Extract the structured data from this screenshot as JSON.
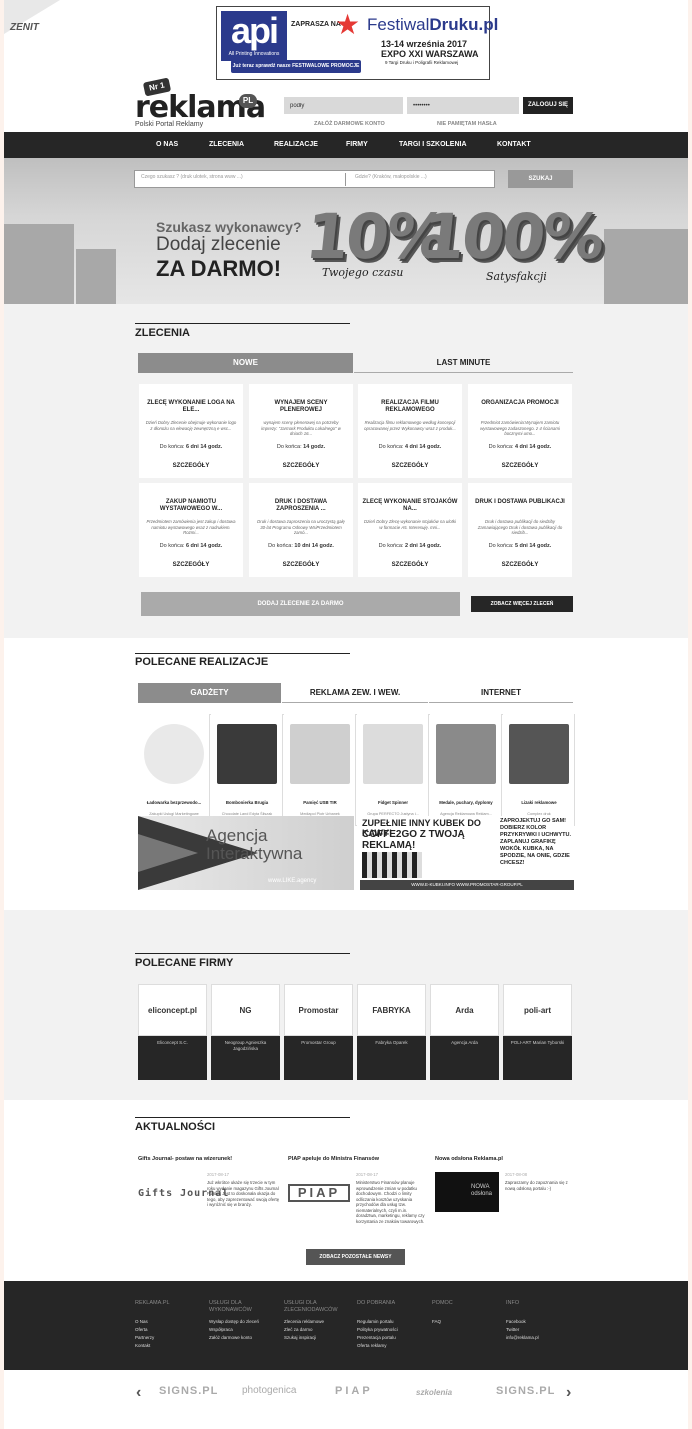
{
  "corner": {
    "text": "ZENIT"
  },
  "banner": {
    "api": "api",
    "api_sub": "All Printing Innovations",
    "zaprasza": "ZAPRASZA NA",
    "festival_a": "Festiwal",
    "festival_b": "Druku.pl",
    "date": "13-14 września 2017",
    "place": "EXPO XXI WARSZAWA",
    "targi": "9 Targi Druku i Poligrafii Reklamowej",
    "button": "Już teraz sprawdź nasze FESTIWALOWE PROMOCJE"
  },
  "header": {
    "logo_badge": "Nr 1",
    "logo": "reklama",
    "logo_pl": "PL",
    "logo_sub": "Polski Portal Reklamy",
    "login_value": "podły",
    "password_value": "••••••••",
    "login_button": "ZALOGUJ SIĘ",
    "create_account": "ZAŁÓŻ DARMOWE KONTO",
    "forgot_password": "NIE PAMIĘTAM HASŁA"
  },
  "nav": [
    "O NAS",
    "ZLECENIA",
    "REALIZACJE",
    "FIRMY",
    "TARGI I SZKOLENIA",
    "KONTAKT"
  ],
  "hero": {
    "search_what": "Czego szukasz ? (druk ulotek, strona www ...)",
    "search_where": "Gdzie? (Kraków, małopolskie ...)",
    "search_button": "SZUKAJ",
    "line1": "Szukasz wykonawcy?",
    "line2": "Dodaj zlecenie",
    "line3": "ZA DARMO!",
    "num1": "10%",
    "num2": "100%",
    "script1": "Twojego czasu",
    "script2": "Satysfakcji"
  },
  "zlecenia": {
    "title": "ZLECENIA",
    "tab_new": "NOWE",
    "tab_last": "LAST MINUTE",
    "deadline_label": "Do końca:",
    "details": "SZCZEGÓŁY",
    "cards": [
      {
        "title": "ZLECĘ WYKONANIE LOGA NA ELE...",
        "desc": "Dzień Dobry Zlecenie obejmuje wykonanie logo z dłonożu na elewację zewnętrzną e wsc...",
        "time": "6 dni 14 godz."
      },
      {
        "title": "WYNAJEM SCENY PLENEROWEJ",
        "desc": "wynajem sceny plenerowej na potrzeby imprezy: \"Jarmark Produktu Lokalnego\" w dniach 16...",
        "time": "14 godz."
      },
      {
        "title": "REALIZACJA FILMU REKLAMOWEGO",
        "desc": "Realizacja filmu reklamowego według koncepcji opracowanej przez Wykonawcy wraz z produk...",
        "time": "4 dni 14 godz."
      },
      {
        "title": "ORGANIZACJA PROMOCJI",
        "desc": "Przedmiot zamówienia:Wynajem zamiotu wystawowego zadaszonego. z 4 ścianami bocznymi umo...",
        "time": "4 dni 14 godz."
      },
      {
        "title": "ZAKUP NAMIOTU WYSTAWOWEGO W...",
        "desc": "Przedmiotem zamówienia jest zakup i dostawa namiotu wystawowego wraz z nadrukiem. Rozmi...",
        "time": "6 dni 14 godz."
      },
      {
        "title": "DRUK I DOSTAWA ZAPROSZENIA ...",
        "desc": "Druk i dostawa zaproszenia na uroczystą galę 30-lat Programu Odnowy WsiPrzedmiotem zamó...",
        "time": "10 dni 14 godz."
      },
      {
        "title": "ZLECĘ WYKONANIE STOJAKÓW NA...",
        "desc": "Dzień Dobry Zlecę wykonanie stojaków na ulotki w formacie A5. Interesuję. mni...",
        "time": "2 dni 14 godz."
      },
      {
        "title": "DRUK I DOSTAWA PUBLIKACJI",
        "desc": "Druk i dostawa publikacji do siedziby Zamawiającego Druk i dostawa publikacji do siedzib...",
        "time": "5 dni 14 godz."
      }
    ],
    "add_button": "DODAJ ZLECENIE ZA DARMO",
    "more_button": "ZOBACZ WIĘCEJ ZLECEŃ"
  },
  "realizacje": {
    "title": "POLECANE REALIZACJE",
    "tabs": [
      "GADŻETY",
      "REKLAMA ZEW. I WEW.",
      "INTERNET"
    ],
    "items": [
      {
        "title": "Ładowarka bezprzewodo...",
        "author": "Zakupki Usługi Marketingowe"
      },
      {
        "title": "Bombonierka Brugia",
        "author": "Chocolate Land Edyta Śliszak"
      },
      {
        "title": "Pamięć USB TIR",
        "author": "Mediapol Piotr Urbanek"
      },
      {
        "title": "Fidget Spinner",
        "author": "Grupa PERFECTO Justyna i..."
      },
      {
        "title": "Medale, puchary, dyplomy",
        "author": "Agencja Reklamowa Reklam..."
      },
      {
        "title": "Lizaki reklamowe",
        "author": "Complex druk"
      }
    ],
    "ad1_line1": "Agencja",
    "ad1_line2": "Interaktywna",
    "ad1_url": "www.LIKE.agency",
    "ad2_line1": "ZUPEŁNIE INNY KUBEK DO KAWY!",
    "ad2_line2": "COFFE2GO Z TWOJĄ REKLAMĄ!",
    "ad2_side": "ZAPROJEKTUJ GO SAM! DOBIERZ KOLOR PRZYKRYWKI I UCHWYTU. ZAPLANUJ GRAFIKĘ WOKÓŁ KUBKA, NA SPODZIE, NA ONIE, GDZIE CHCESZ!",
    "ad2_footer": "WWW.E-KUBKI.INFO   WWW.PROMOSTAR-GROUP.PL"
  },
  "firmy": {
    "title": "POLECANE FIRMY",
    "items": [
      {
        "logo": "eliconcept.pl",
        "name": "Eliconcept S.C."
      },
      {
        "logo": "NG",
        "name": "Neogroup Agnieszka Jagodzińska"
      },
      {
        "logo": "Promostar",
        "name": "Promostar Group"
      },
      {
        "logo": "FABRYKA OPAREK",
        "name": "Fabryka Oparek"
      },
      {
        "logo": "Arda",
        "name": "Agencja Arda"
      },
      {
        "logo": "poli-art",
        "name": "POLI-ART Marian Tyborski"
      }
    ]
  },
  "news": {
    "title": "AKTUALNOŚCI",
    "items": [
      {
        "title": "Gifts Journal- postaw na wizerunek!",
        "date": "2017-08-17",
        "logo": "Gifts Journal",
        "text": "Już wkrótce ukaże się trzecie w tym roku wydanie magazynu Gifts Journal Polska. Jest to doskonała okazja do tego, aby zaprezentować swoją ofertę i wyróżnić się w branży."
      },
      {
        "title": "PIAP apeluje do Ministra Finansów",
        "date": "2017-08-17",
        "logo": "PIAP",
        "text": "Ministerstwo Finansów planuje wprowadzenie zmian w podatku dochodowym. Chodzi o limity odliczania kosztów uzyskania przychodów dla usług tzw. niematerialnych, czyli m.in. doradztwa, marketingu, reklamy czy korzystania ze znaków towarowych."
      },
      {
        "title": "Nowa odsłona Reklama.pl",
        "date": "2017-08-08",
        "logo": "NOWA odsłona",
        "text": "Zapraszamy do zapoznania się z nową odsłoną portalu :-)"
      }
    ],
    "more_button": "ZOBACZ POZOSTAŁE NEWSY"
  },
  "footer": {
    "columns": [
      {
        "head": "REKLAMA.PL",
        "links": [
          "O Nas",
          "Oferta",
          "Partnerzy",
          "Kontakt"
        ]
      },
      {
        "head": "USŁUGI DLA WYKONAWCÓW",
        "links": [
          "Wysłap dostęp do zleceń",
          "Współpraca",
          "Załóż darmowe konto"
        ]
      },
      {
        "head": "USŁUGI DLA ZLECENIODAWCÓW",
        "links": [
          "Zlecenia reklamowe",
          "Zleć za darmo",
          "Szukaj inspiracji"
        ]
      },
      {
        "head": "DO POBRANIA",
        "links": [
          "Regulamin portalu",
          "Polityka prywatności",
          "Prezentacja portalu",
          "Oferta reklamy"
        ]
      },
      {
        "head": "POMOC",
        "links": [
          "FAQ"
        ]
      },
      {
        "head": "INFO",
        "links": [
          "Facebook",
          "Twitter",
          "info@reklama.pl"
        ]
      }
    ]
  },
  "partners": [
    "SIGNS.PL",
    "photogenica",
    "PIAP",
    "szkolenia",
    "SIGNS.PL"
  ]
}
